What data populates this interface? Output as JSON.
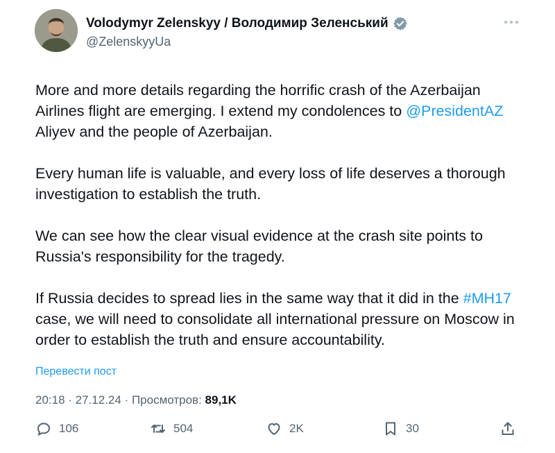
{
  "author": {
    "display_name": "Volodymyr Zelenskyy / Володимир Зеленський",
    "handle": "@ZelenskyyUa",
    "verified": true
  },
  "tweet": {
    "paragraphs": [
      {
        "a": "More and more details regarding the horrific crash of the Azerbaijan Airlines flight are emerging. I extend my condolences to ",
        "link": "@PresidentAZ",
        "b": " Aliyev and the people of Azerbaijan."
      },
      {
        "text": "Every human life is valuable, and every loss of life deserves a thorough investigation to establish the truth."
      },
      {
        "text": "We can see how the clear visual evidence at the crash site points to Russia's responsibility for the tragedy."
      },
      {
        "a": "If Russia decides to spread lies in the same way that it did in the ",
        "link": "#MH17",
        "b": " case, we will need to consolidate all international pressure on Moscow in order to establish the truth and ensure accountability."
      }
    ],
    "translate_label": "Перевести пост"
  },
  "meta": {
    "time": "20:18",
    "date": "27.12.24",
    "views_label": "Просмотров:",
    "views_count": "89,1K",
    "separator": " · "
  },
  "actions": {
    "replies": "106",
    "reposts": "504",
    "likes": "2K",
    "bookmarks": "30"
  },
  "colors": {
    "link": "#1d9bf0",
    "text": "#0f1419",
    "muted": "#536471",
    "verified": "#829aab"
  }
}
